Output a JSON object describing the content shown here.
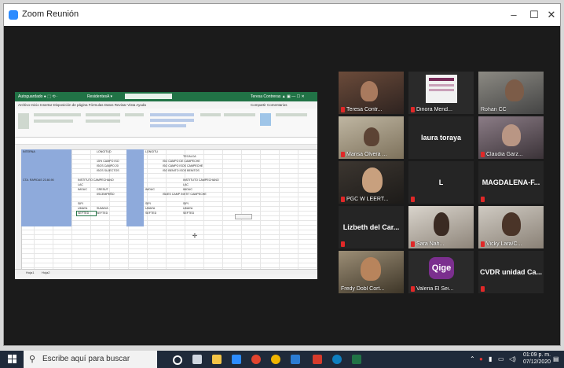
{
  "window": {
    "title": "Zoom Reunión",
    "min_icon": "minimize-icon",
    "max_icon": "maximize-icon",
    "close_icon": "close-icon"
  },
  "shared_screen": {
    "app": "Excel",
    "cells": {
      "col_a_1": "INTERNA",
      "col_a_2": "CTA. RAPIDAS 23.60.90",
      "col_c_1": "LONGITUD",
      "col_c_2": "15% CAMPO ISO",
      "col_c_3": "ISOS CAMPO 20",
      "col_c_4": "ISOS SUJECTOS",
      "col_c_5": "INSTITUTO CAMPECHANO",
      "col_c_6": "LAC",
      "col_c_7": "IMOUC",
      "col_c_8": "CRESUT",
      "col_c_9": "SIPI",
      "col_c_10": "UMAYA",
      "col_c_11": "SEFTED",
      "col_d_1": "IISCEMPEÑO",
      "col_d_2": "SUMAYA",
      "col_d_3": "SEFTED",
      "col_f_1": "LONGITU",
      "col_f_2": "IMOUC",
      "col_f_3": "SIPI",
      "col_f_4": "UMAYA",
      "col_f_5": "SEFTED",
      "col_h_1": "TECALCA",
      "col_h_2": "ISO CAMPO DE CAMPECHE",
      "col_h_3": "ISO CAMPO ISOS CAMPECHE",
      "col_h_4": "ISO BENITO ISOS BENITOS",
      "col_h_5": "INSTITUTO CAMPECHANO",
      "col_h_6": "LAC",
      "col_h_7": "IMOUC",
      "col_h_8": "ISDES CAMP INSTIT CAMPECHE",
      "col_h_9": "SIPI",
      "col_h_10": "UMAYA",
      "col_h_11": "SEFTED",
      "sheet_tabs": [
        "Hoja1",
        "Hoja2"
      ]
    }
  },
  "participants": [
    {
      "name": "Teresa Contr...",
      "muted": true
    },
    {
      "name": "Dinora Mend...",
      "muted": true
    },
    {
      "name": "Rohan CC",
      "muted": false
    },
    {
      "name": "Marisa Olvera ...",
      "muted": true,
      "active": true
    },
    {
      "name": "laura toraya",
      "muted": false,
      "video": false
    },
    {
      "name": "Claudia Garz...",
      "muted": true
    },
    {
      "name": "PGC W LEERT...",
      "muted": true
    },
    {
      "name": "L",
      "muted": true,
      "video": false
    },
    {
      "name": "MAGDALENA-F...",
      "muted": true,
      "video": false
    },
    {
      "name": "Lizbeth del Car...",
      "muted": true,
      "video": false
    },
    {
      "name": "Sara Nah...",
      "muted": true
    },
    {
      "name": "Vicky Lara/C...",
      "muted": true
    },
    {
      "name": "Fredy Dobl Cort...",
      "muted": false
    },
    {
      "name": "Valeria El Sei...",
      "muted": true
    },
    {
      "name": "CVDR unidad Ca...",
      "muted": true,
      "video": false
    }
  ],
  "taskbar": {
    "search_placeholder": "Escribe aquí para buscar",
    "time": "01:09 p. m.",
    "date": "07/12/2020"
  }
}
